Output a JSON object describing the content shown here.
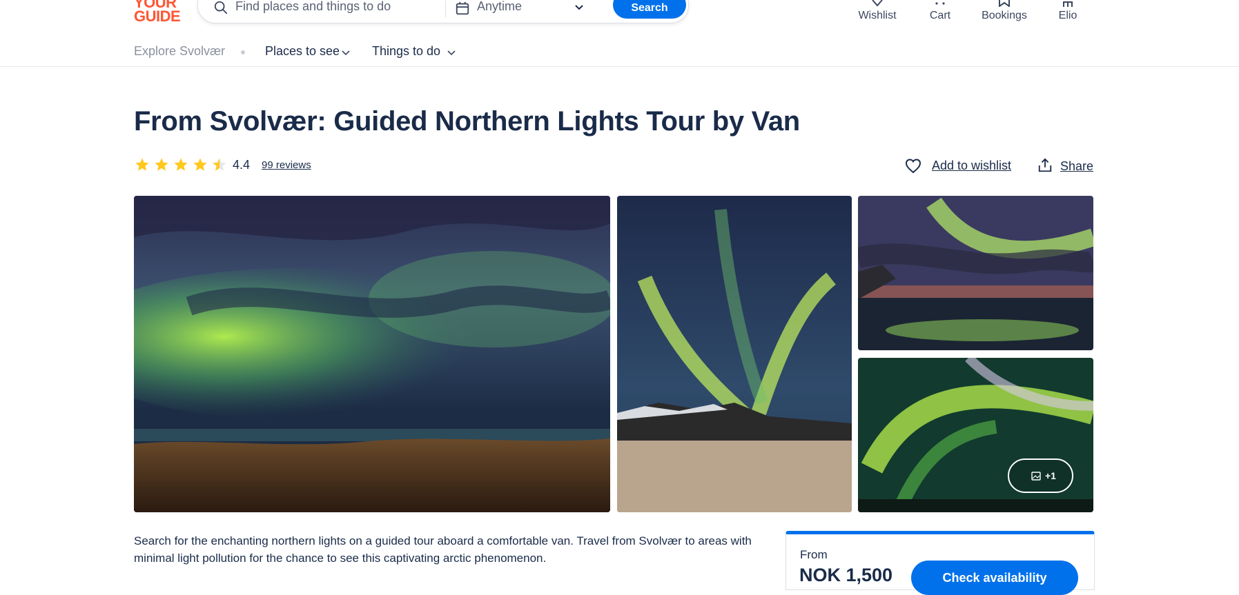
{
  "header": {
    "logo": {
      "line1": "YOUR",
      "line2": "GUIDE"
    },
    "search": {
      "placeholder": "Find places and things to do",
      "date_label": "Anytime",
      "button_label": "Search"
    },
    "nav": {
      "wishlist": "Wishlist",
      "cart": "Cart",
      "bookings": "Bookings",
      "account": "Elio"
    }
  },
  "subnav": {
    "explore": "Explore Svolvær",
    "places": "Places to see",
    "things": "Things to do"
  },
  "activity": {
    "title": "From Svolvær: Guided Northern Lights Tour by Van",
    "rating_value": 4.4,
    "rating": "4.4",
    "reviews_label": "99 reviews",
    "add_to_wishlist": "Add to wishlist",
    "share": "Share",
    "more_photos": "+1",
    "description": "Search for the enchanting northern lights on a guided tour aboard a comfortable van. Travel from Svolvær to areas with minimal light pollution for the chance to see this captivating arctic phenomenon."
  },
  "booking": {
    "from_label": "From",
    "price": "NOK 1,500",
    "check_availability": "Check availability"
  },
  "colors": {
    "brand": "#ff5533",
    "primary": "#0071eb",
    "text": "#1a2b49",
    "star": "#ffc81e"
  }
}
